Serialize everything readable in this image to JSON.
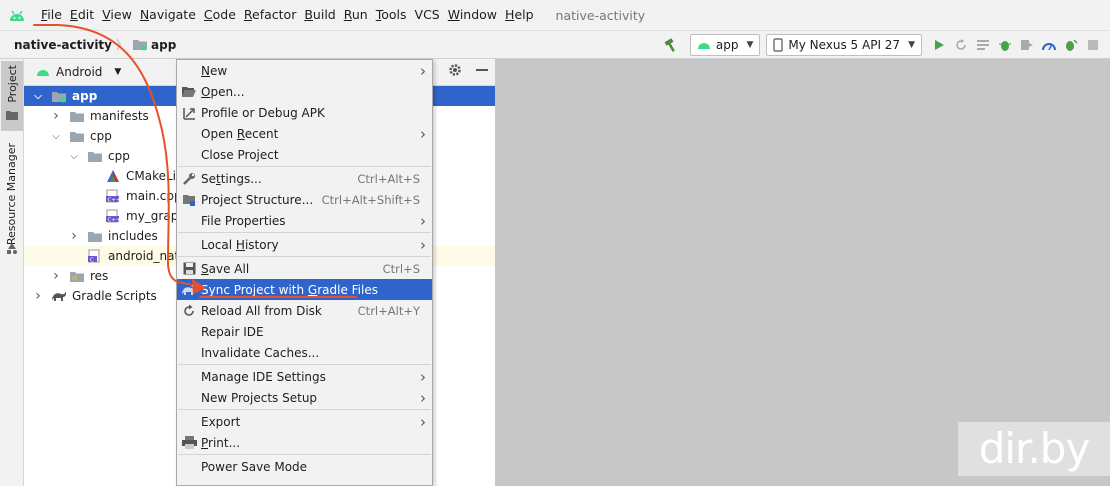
{
  "window": {
    "project_title": "native-activity"
  },
  "menubar": {
    "items": [
      {
        "label": "File",
        "mnemonic": "F",
        "rest": "ile"
      },
      {
        "label": "Edit",
        "mnemonic": "E",
        "rest": "dit"
      },
      {
        "label": "View",
        "mnemonic": "V",
        "rest": "iew"
      },
      {
        "label": "Navigate",
        "mnemonic": "N",
        "rest": "avigate"
      },
      {
        "label": "Code",
        "mnemonic": "C",
        "rest": "ode"
      },
      {
        "label": "Refactor",
        "mnemonic": "R",
        "rest": "efactor"
      },
      {
        "label": "Build",
        "mnemonic": "B",
        "rest": "uild"
      },
      {
        "label": "Run",
        "mnemonic": "R",
        "rest": "un"
      },
      {
        "label": "Tools",
        "mnemonic": "T",
        "rest": "ools"
      },
      {
        "label": "VCS",
        "mnemonic": "",
        "rest": "VCS"
      },
      {
        "label": "Window",
        "mnemonic": "W",
        "rest": "indow"
      },
      {
        "label": "Help",
        "mnemonic": "H",
        "rest": "elp"
      }
    ]
  },
  "navbar": {
    "crumb_root": "native-activity",
    "crumb_app": "app",
    "run_config": "app",
    "device": "My Nexus 5 API 27"
  },
  "tool_strip": {
    "project_tab": "Project",
    "resource_tab": "Resource Manager"
  },
  "project_panel": {
    "view": "Android",
    "tree": [
      {
        "label": "app",
        "depth": 0,
        "chevron": "open",
        "icon": "app-module-icon",
        "selected": true
      },
      {
        "label": "manifests",
        "depth": 1,
        "chevron": "closed",
        "icon": "folder-icon"
      },
      {
        "label": "cpp",
        "depth": 1,
        "chevron": "open",
        "icon": "folder-icon"
      },
      {
        "label": "cpp",
        "depth": 2,
        "chevron": "open",
        "icon": "folder-icon"
      },
      {
        "label": "CMakeLists.txt",
        "depth": 3,
        "chevron": "none",
        "icon": "cmake-icon"
      },
      {
        "label": "main.cpp",
        "depth": 3,
        "chevron": "none",
        "icon": "cpp-file-icon"
      },
      {
        "label": "my_graphics.cpp",
        "depth": 3,
        "chevron": "none",
        "icon": "cpp-file-icon"
      },
      {
        "label": "includes",
        "depth": 2,
        "chevron": "closed",
        "icon": "folder-icon"
      },
      {
        "label": "android_native_app_glue.c",
        "depth": 2,
        "chevron": "none",
        "icon": "c-file-icon",
        "highlight": true
      },
      {
        "label": "res",
        "depth": 1,
        "chevron": "closed",
        "icon": "res-folder-icon"
      },
      {
        "label": "Gradle Scripts",
        "depth": 0,
        "chevron": "closed",
        "icon": "gradle-icon"
      }
    ]
  },
  "file_menu": {
    "items": [
      {
        "label": "New",
        "u": "N",
        "shortcut": "",
        "submenu": true,
        "icon": ""
      },
      {
        "label": "Open...",
        "u": "O",
        "shortcut": "",
        "submenu": false,
        "icon": "open-folder-icon"
      },
      {
        "label": "Profile or Debug APK",
        "u": "",
        "shortcut": "",
        "submenu": false,
        "icon": "apk-icon"
      },
      {
        "label": "Open Recent",
        "u": "R",
        "shortcut": "",
        "submenu": true,
        "icon": ""
      },
      {
        "label": "Close Project",
        "u": "",
        "shortcut": "",
        "submenu": false,
        "icon": ""
      },
      {
        "label": "Settings...",
        "u": "t",
        "shortcut": "Ctrl+Alt+S",
        "submenu": false,
        "icon": "wrench-icon"
      },
      {
        "label": "Project Structure...",
        "u": "",
        "shortcut": "Ctrl+Alt+Shift+S",
        "submenu": false,
        "icon": "project-structure-icon"
      },
      {
        "label": "File Properties",
        "u": "",
        "shortcut": "",
        "submenu": true,
        "icon": ""
      },
      {
        "label": "Local History",
        "u": "H",
        "shortcut": "",
        "submenu": true,
        "icon": ""
      },
      {
        "label": "Save All",
        "u": "S",
        "shortcut": "Ctrl+S",
        "submenu": false,
        "icon": "save-icon"
      },
      {
        "label": "Sync Project with Gradle Files",
        "u": "G",
        "shortcut": "",
        "submenu": false,
        "icon": "gradle-sync-icon",
        "active": true
      },
      {
        "label": "Reload All from Disk",
        "u": "",
        "shortcut": "Ctrl+Alt+Y",
        "submenu": false,
        "icon": "reload-icon"
      },
      {
        "label": "Repair IDE",
        "u": "",
        "shortcut": "",
        "submenu": false,
        "icon": ""
      },
      {
        "label": "Invalidate Caches...",
        "u": "",
        "shortcut": "",
        "submenu": false,
        "icon": ""
      },
      {
        "label": "Manage IDE Settings",
        "u": "",
        "shortcut": "",
        "submenu": true,
        "icon": ""
      },
      {
        "label": "New Projects Setup",
        "u": "",
        "shortcut": "",
        "submenu": true,
        "icon": ""
      },
      {
        "label": "Export",
        "u": "",
        "shortcut": "",
        "submenu": true,
        "icon": ""
      },
      {
        "label": "Print...",
        "u": "P",
        "shortcut": "",
        "submenu": false,
        "icon": "print-icon"
      },
      {
        "label": "Power Save Mode",
        "u": "",
        "shortcut": "",
        "submenu": false,
        "icon": ""
      }
    ]
  },
  "watermark": "dir.by",
  "colors": {
    "selection": "#2f65ca",
    "android_green": "#3ddc84",
    "annotation": "#e8502a"
  }
}
